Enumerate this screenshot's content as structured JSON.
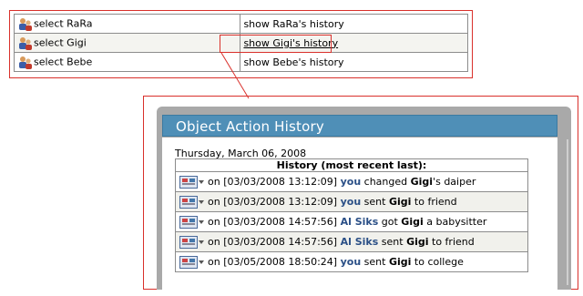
{
  "top_list": {
    "rows": [
      {
        "select_label": "select RaRa",
        "history_label": "show RaRa's history"
      },
      {
        "select_label": "select Gigi",
        "history_label": "show Gigi's history"
      },
      {
        "select_label": "select Bebe",
        "history_label": "show Bebe's history"
      }
    ]
  },
  "panel": {
    "title": "Object Action History",
    "date": "Thursday, March 06, 2008",
    "table_header": "History (most recent last):",
    "entries": [
      {
        "prefix": "on [03/03/2008 13:12:09]",
        "actor": "you",
        "verb": "changed",
        "object": "Gigi",
        "tail": "'s daiper"
      },
      {
        "prefix": "on [03/03/2008 13:12:09]",
        "actor": "you",
        "verb": "sent",
        "object": "Gigi",
        "tail": "to friend"
      },
      {
        "prefix": "on [03/03/2008 14:57:56]",
        "actor": "Al Siks",
        "verb": "got",
        "object": "Gigi",
        "tail": "a babysitter"
      },
      {
        "prefix": "on [03/03/2008 14:57:56]",
        "actor": "Al Siks",
        "verb": "sent",
        "object": "Gigi",
        "tail": "to friend"
      },
      {
        "prefix": "on [03/05/2008 18:50:24]",
        "actor": "you",
        "verb": "sent",
        "object": "Gigi",
        "tail": "to college"
      }
    ]
  },
  "colors": {
    "callout_border": "#d9302b",
    "header_bg": "#4f8fb7",
    "actor_text": "#2a4f86"
  }
}
